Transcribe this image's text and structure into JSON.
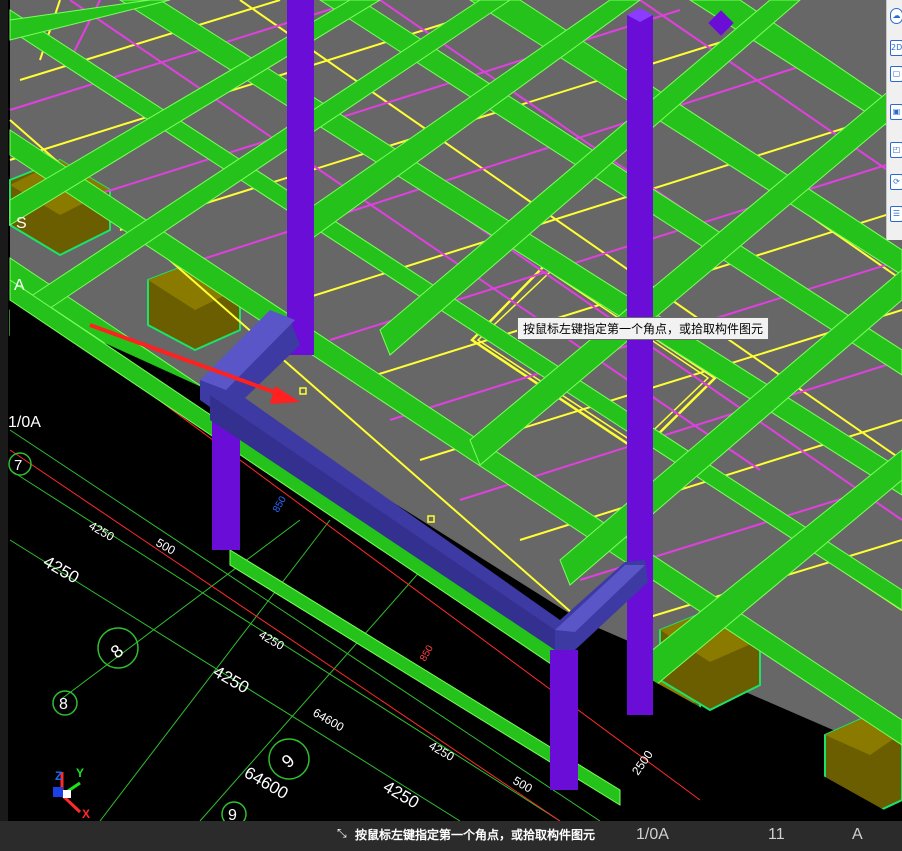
{
  "viewport": {
    "tooltip": "按鼠标左键指定第一个角点，或拾取构件图元",
    "status_prompt": "按鼠标左键指定第一个角点，或拾取构件图元",
    "status_axes": [
      "1/0A",
      "11",
      "A"
    ],
    "grid_labels": {
      "axis_S": "S",
      "axis_A": "A",
      "axis_1_0A": "1/0A",
      "axis_7": "7",
      "axis_8_circ": "8",
      "axis_8": "8",
      "axis_9_circ": "9",
      "axis_9": "9"
    },
    "dimensions": {
      "d1": "4250",
      "d2": "500",
      "d3": "4250",
      "d4": "4250",
      "d5": "4250",
      "d6": "64600",
      "d7": "64600",
      "d8": "4250",
      "d9": "4250",
      "d10": "500",
      "d11": "2500",
      "d12": "850",
      "d13": "850"
    },
    "compass": {
      "z": "Z",
      "y": "Y",
      "x": "X"
    }
  },
  "toolbar": {
    "icons": [
      "cloud-icon",
      "2d-icon",
      "box-icon",
      "box-front-icon",
      "box-corner-icon",
      "orbit-icon",
      "list-icon"
    ]
  },
  "colors": {
    "beam_green": "#26c21c",
    "column_purple": "#6a0dd6",
    "wall_blue": "#3d3aa3",
    "slab_gray": "#666666",
    "footing_olive": "#6b5e00",
    "rebar_yellow": "#ffff33",
    "rebar_magenta": "#e040e0"
  }
}
